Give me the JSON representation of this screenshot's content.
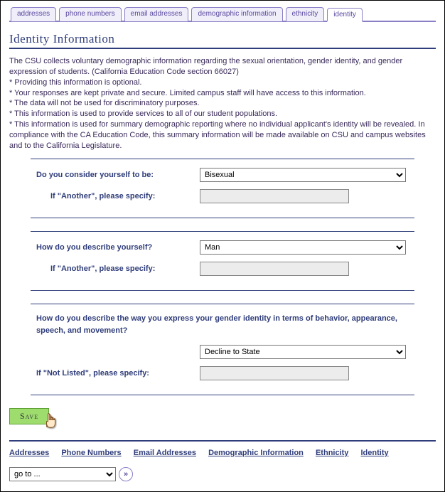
{
  "tabs": [
    {
      "label": "addresses"
    },
    {
      "label": "phone numbers"
    },
    {
      "label": "email addresses"
    },
    {
      "label": "demographic information"
    },
    {
      "label": "ethnicity"
    },
    {
      "label": "identity"
    }
  ],
  "active_tab_index": 5,
  "heading": "Identity Information",
  "intro": {
    "p1": "The CSU collects voluntary demographic information regarding the sexual orientation, gender identity, and gender expression of students. (California Education Code section 66027)",
    "b1": "* Providing this information is optional.",
    "b2": "* Your responses are kept private and secure. Limited campus staff will have access to this information.",
    "b3": "* The data will not be used for discriminatory purposes.",
    "b4": "* This information is used to provide services to all of our student populations.",
    "b5": "* This information is used for summary demographic reporting where no individual applicant's identity will be revealed. In compliance with the CA Education Code, this summary information will be made available on CSU and campus websites and to the California Legislature."
  },
  "q1": {
    "label": "Do you consider yourself to be:",
    "value": "Bisexual",
    "specify_label": "If \"Another\", please specify:",
    "specify_value": ""
  },
  "q2": {
    "label": "How do you describe yourself?",
    "value": "Man",
    "specify_label": "If \"Another\", please specify:",
    "specify_value": ""
  },
  "q3": {
    "label": "How do you describe the way you express your gender identity in terms of behavior, appearance, speech, and movement?",
    "value": "Decline to State",
    "specify_label": "If \"Not Listed\", please specify:",
    "specify_value": ""
  },
  "save_label": "Save",
  "bottom_links": [
    "Addresses",
    "Phone Numbers",
    "Email Addresses",
    "Demographic Information",
    "Ethnicity",
    "Identity"
  ],
  "goto": {
    "placeholder": "go to ...",
    "button_glyph": "»"
  }
}
